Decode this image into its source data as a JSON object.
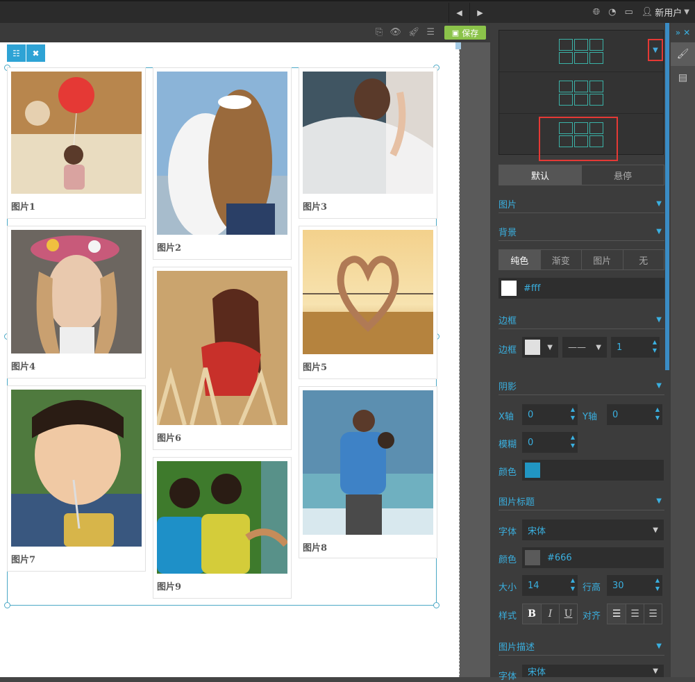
{
  "topbar": {
    "user_label": "新用户",
    "prev_label": "◀",
    "next_label": "▶"
  },
  "toolbar": {
    "save_label": "保存"
  },
  "gallery": {
    "items": [
      {
        "caption": "图片1"
      },
      {
        "caption": "图片2"
      },
      {
        "caption": "图片3"
      },
      {
        "caption": "图片4"
      },
      {
        "caption": "图片5"
      },
      {
        "caption": "图片6"
      },
      {
        "caption": "图片7"
      },
      {
        "caption": "图片8"
      },
      {
        "caption": "图片9"
      }
    ]
  },
  "panel": {
    "state_tabs": [
      "默认",
      "悬停"
    ],
    "sections": {
      "image": "图片",
      "background": "背景",
      "border": "边框",
      "shadow": "阴影",
      "image_title": "图片标题",
      "image_desc": "图片描述"
    },
    "bg_tabs": [
      "纯色",
      "渐变",
      "图片",
      "无"
    ],
    "bg_color_value": "#fff",
    "bg_color_hex": "#ffffff",
    "border": {
      "label": "边框",
      "color_hex": "#e0e0e0",
      "style": "——",
      "width": "1"
    },
    "shadow": {
      "x_label": "X轴",
      "x_value": "0",
      "y_label": "Y轴",
      "y_value": "0",
      "blur_label": "模糊",
      "blur_value": "0",
      "color_label": "颜色",
      "color_hex": "#2196c3"
    },
    "title_font": {
      "font_label": "字体",
      "font_value": "宋体",
      "color_label": "颜色",
      "color_value": "#666",
      "color_hex": "#5a5a5a",
      "size_label": "大小",
      "size_value": "14",
      "line_height_label": "行高",
      "line_height_value": "30",
      "style_label": "样式",
      "align_label": "对齐"
    },
    "desc_font": {
      "font_label": "字体",
      "font_value": "宋体"
    }
  }
}
